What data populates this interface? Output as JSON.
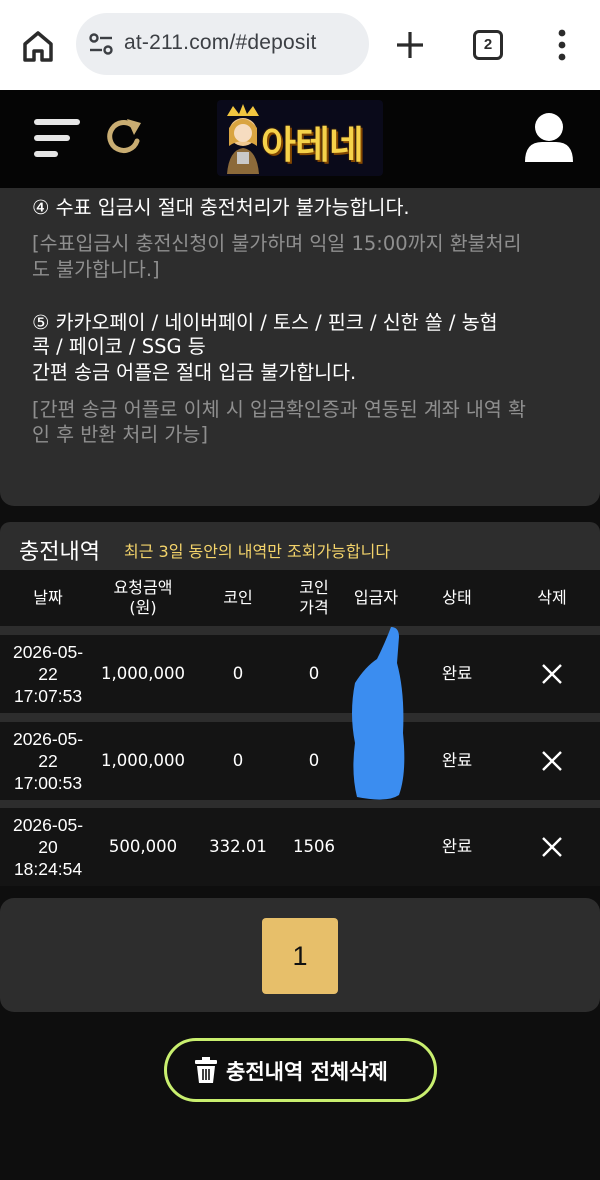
{
  "browser": {
    "url": "at-211.com/#deposit",
    "tab_count": "2"
  },
  "header": {
    "logo_text": "아테네"
  },
  "notice": {
    "item4": {
      "title": "④ 수표 입금시 절대 충전처리가 불가능합니다.",
      "detail_line1": "[수표입금시 충전신청이 불가하며 익일 15:00까지 환불처리",
      "detail_line2": "도 불가합니다.]"
    },
    "item5": {
      "line1": "⑤ 카카오페이 / 네이버페이 / 토스 / 핀크 / 신한 쏠 / 농협",
      "line2": "콕 / 페이코 / SSG 등",
      "line3": "간편 송금 어플은 절대 입금 불가합니다.",
      "detail_line1": "[간편 송금 어플로 이체 시 입금확인증과 연동된 계좌 내역 확",
      "detail_line2": "인 후 반환 처리 가능]"
    }
  },
  "history": {
    "title": "충전내역",
    "note": "최근 3일 동안의 내역만 조회가능합니다",
    "columns": {
      "date": "날짜",
      "amount": "요청금액\n(원)",
      "coin": "코인",
      "coin_price": "코인\n가격",
      "depositor": "입금자",
      "status": "상태",
      "delete": "삭제"
    },
    "rows": [
      {
        "date": "2026-05-\n22\n17:07:53",
        "amount": "1,000,000",
        "coin": "0",
        "coin_price": "0",
        "depositor": "",
        "status": "완료"
      },
      {
        "date": "2026-05-\n22\n17:00:53",
        "amount": "1,000,000",
        "coin": "0",
        "coin_price": "0",
        "depositor": "",
        "status": "완료"
      },
      {
        "date": "2026-05-\n20\n18:24:54",
        "amount": "500,000",
        "coin": "332.01",
        "coin_price": "1506",
        "depositor": "",
        "status": "완료"
      }
    ]
  },
  "pagination": {
    "current_page": "1"
  },
  "actions": {
    "delete_all_label": "충전내역 전체삭제"
  },
  "colors": {
    "accent_gold": "#e7bf6a",
    "note_yellow": "#f3d36a",
    "button_border_green": "#c9ef6f",
    "redaction_blue": "#3b8df0"
  }
}
